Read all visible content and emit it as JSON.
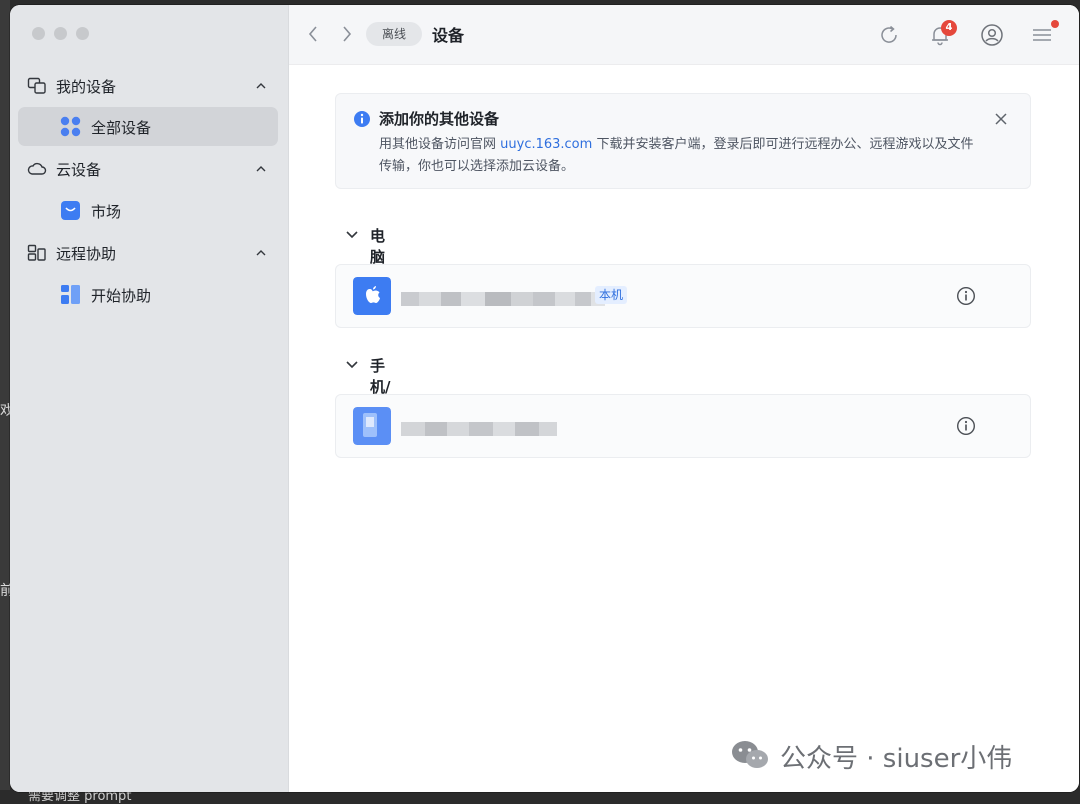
{
  "sidebar": {
    "groups": [
      {
        "label": "我的设备",
        "items": [
          {
            "label": "全部设备",
            "active": true
          }
        ]
      },
      {
        "label": "云设备",
        "items": [
          {
            "label": "市场",
            "active": false
          }
        ]
      },
      {
        "label": "远程协助",
        "items": [
          {
            "label": "开始协助",
            "active": false
          }
        ]
      }
    ]
  },
  "topbar": {
    "status": "离线",
    "title": "设备",
    "notification_count": "4"
  },
  "banner": {
    "title": "添加你的其他设备",
    "text_before": "用其他设备访问官网 ",
    "link": "uuyc.163.com",
    "text_after": " 下载并安装客户端，登录后即可进行远程办公、远程游戏以及文件传输，你也可以选择添加云设备。"
  },
  "sections": [
    {
      "title": "电脑",
      "count": "1",
      "devices": [
        {
          "tag": "本机"
        }
      ]
    },
    {
      "title": "手机/平板",
      "count": "1",
      "devices": [
        {
          "tag": ""
        }
      ]
    }
  ],
  "watermark": {
    "text": "公众号 · siuser小伟"
  },
  "background": {
    "bottom_text": "需要调整 prompt",
    "left_chars": [
      "戏",
      "前"
    ]
  },
  "colors": {
    "accent": "#2f6fde",
    "badge": "#e5483c",
    "sidebar_bg": "#e3e5e8"
  },
  "icons": {
    "groups": [
      "devices-icon",
      "cloud-icon",
      "remote-assist-icon"
    ],
    "items": [
      "grid-dots-icon",
      "shopping-bag-icon",
      "start-assist-icon"
    ]
  }
}
